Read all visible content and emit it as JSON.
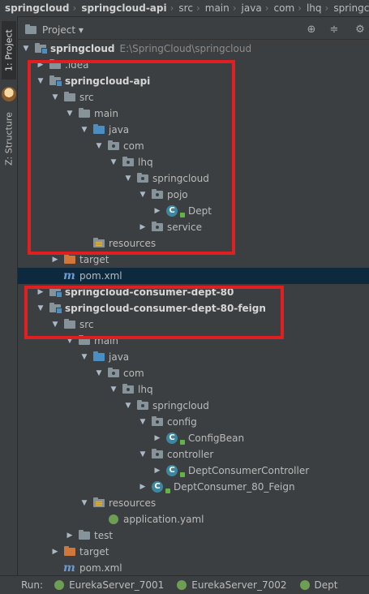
{
  "breadcrumb": [
    "springcloud",
    "springcloud-api",
    "src",
    "main",
    "java",
    "com",
    "lhq",
    "springclo"
  ],
  "sidebar": {
    "project_tab": "1: Project",
    "structure_tab": "Z: Structure"
  },
  "panel": {
    "title": "Project ▾",
    "icons": [
      "crosshair-icon",
      "collapse-icon",
      "gear-icon"
    ]
  },
  "tree": [
    {
      "label": "springcloud",
      "bold": true,
      "path": "E:\\SpringCloud\\springcloud",
      "icon": "module-folder-icon",
      "depth": 0,
      "arrow": "open"
    },
    {
      "label": ".idea",
      "icon": "folder-icon",
      "depth": 1,
      "arrow": "closed"
    },
    {
      "label": "springcloud-api",
      "bold": true,
      "icon": "module-folder-icon",
      "depth": 1,
      "arrow": "open"
    },
    {
      "label": "src",
      "icon": "folder-icon",
      "depth": 2,
      "arrow": "open"
    },
    {
      "label": "main",
      "icon": "folder-icon",
      "depth": 3,
      "arrow": "open"
    },
    {
      "label": "java",
      "icon": "source-folder-icon",
      "depth": 4,
      "arrow": "open"
    },
    {
      "label": "com",
      "icon": "package-icon",
      "depth": 5,
      "arrow": "open"
    },
    {
      "label": "lhq",
      "icon": "package-icon",
      "depth": 6,
      "arrow": "open"
    },
    {
      "label": "springcloud",
      "icon": "package-icon",
      "depth": 7,
      "arrow": "open"
    },
    {
      "label": "pojo",
      "icon": "package-icon",
      "depth": 8,
      "arrow": "open"
    },
    {
      "label": "Dept",
      "icon": "class-icon",
      "depth": 9,
      "arrow": "closed"
    },
    {
      "label": "service",
      "icon": "package-icon",
      "depth": 8,
      "arrow": "closed"
    },
    {
      "label": "resources",
      "icon": "resources-folder-icon",
      "depth": 4,
      "arrow": "none"
    },
    {
      "label": "target",
      "icon": "target-folder-icon",
      "depth": 2,
      "arrow": "closed"
    },
    {
      "label": "pom.xml",
      "icon": "maven-icon",
      "depth": 2,
      "arrow": "none",
      "selected": true
    },
    {
      "label": "springcloud-consumer-dept-80",
      "bold": true,
      "icon": "module-folder-icon",
      "depth": 1,
      "arrow": "closed"
    },
    {
      "label": "springcloud-consumer-dept-80-feign",
      "bold": true,
      "icon": "module-folder-icon",
      "depth": 1,
      "arrow": "open"
    },
    {
      "label": "src",
      "icon": "folder-icon",
      "depth": 2,
      "arrow": "open"
    },
    {
      "label": "main",
      "icon": "folder-icon",
      "depth": 3,
      "arrow": "open"
    },
    {
      "label": "java",
      "icon": "source-folder-icon",
      "depth": 4,
      "arrow": "open"
    },
    {
      "label": "com",
      "icon": "package-icon",
      "depth": 5,
      "arrow": "open"
    },
    {
      "label": "lhq",
      "icon": "package-icon",
      "depth": 6,
      "arrow": "open"
    },
    {
      "label": "springcloud",
      "icon": "package-icon",
      "depth": 7,
      "arrow": "open"
    },
    {
      "label": "config",
      "icon": "package-icon",
      "depth": 8,
      "arrow": "open"
    },
    {
      "label": "ConfigBean",
      "icon": "class-icon",
      "depth": 9,
      "arrow": "closed"
    },
    {
      "label": "controller",
      "icon": "package-icon",
      "depth": 8,
      "arrow": "open"
    },
    {
      "label": "DeptConsumerController",
      "icon": "class-icon",
      "depth": 9,
      "arrow": "closed"
    },
    {
      "label": "DeptConsumer_80_Feign",
      "icon": "spring-class-icon",
      "depth": 8,
      "arrow": "closed"
    },
    {
      "label": "resources",
      "icon": "resources-folder-icon",
      "depth": 4,
      "arrow": "open"
    },
    {
      "label": "application.yaml",
      "icon": "yaml-icon",
      "depth": 5,
      "arrow": "none"
    },
    {
      "label": "test",
      "icon": "folder-icon",
      "depth": 3,
      "arrow": "closed"
    },
    {
      "label": "target",
      "icon": "target-folder-icon",
      "depth": 2,
      "arrow": "closed"
    },
    {
      "label": "pom.xml",
      "icon": "maven-icon",
      "depth": 2,
      "arrow": "none"
    }
  ],
  "run_bar": {
    "label": "Run:",
    "tabs": [
      "EurekaServer_7001",
      "EurekaServer_7002",
      "Dept"
    ]
  },
  "colors": {
    "highlight": "#e02020",
    "selection": "#0d293e",
    "background": "#3c3f41"
  }
}
